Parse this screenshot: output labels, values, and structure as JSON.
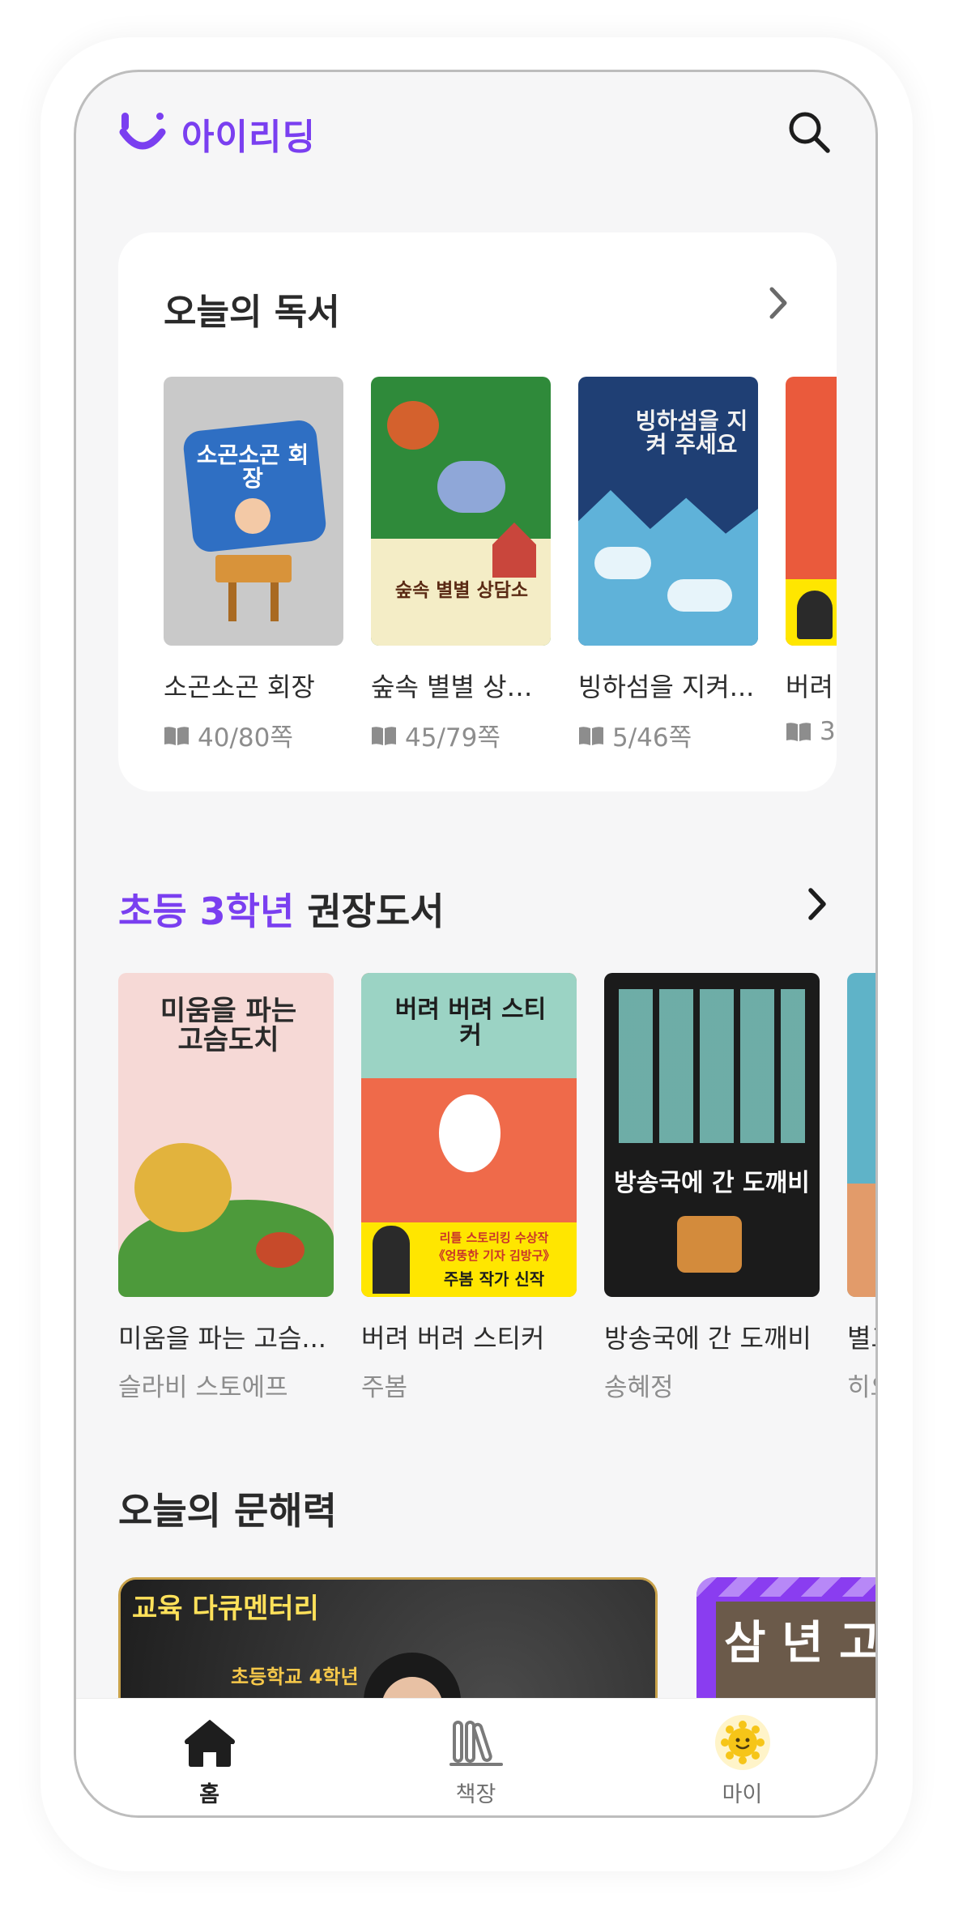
{
  "app": {
    "logo_text": "아이리딩",
    "accent_color": "#7a3ff0"
  },
  "header": {
    "search_icon": "search-icon"
  },
  "today_reading": {
    "title": "오늘의 독서",
    "books": [
      {
        "title": "소곤소곤 회장",
        "progress": "40/80쪽",
        "cover_text": "소곤소곤 회장"
      },
      {
        "title": "숲속 별별 상담소",
        "progress": "45/79쪽",
        "cover_text": "숲속 별별 상담소"
      },
      {
        "title": "빙하섬을 지켜...",
        "progress": "5/46쪽",
        "cover_text": "빙하섬을 지켜 주세요"
      },
      {
        "title": "버려",
        "progress": "3"
      }
    ]
  },
  "grade_section": {
    "highlight": "초등 3학년",
    "rest": " 권장도서",
    "books": [
      {
        "title": "미움을 파는 고슴...",
        "author": "슬라비 스토에프",
        "cover_text": "미움을 파는 고슴도치"
      },
      {
        "title": "버려 버려 스티커",
        "author": "주봄",
        "cover_text": "버려 버려 스티커",
        "banner_line1": "리틀 스토리킹 수상작",
        "banner_line2": "《엉뚱한 기자 김방구》",
        "banner_line3": "주봄 작가 신작"
      },
      {
        "title": "방송국에 간 도깨비",
        "author": "송혜정",
        "cover_text": "방송국에 간 도깨비"
      },
      {
        "title": "별고",
        "author": "히요"
      }
    ]
  },
  "literacy": {
    "title": "오늘의 문해력",
    "videos": [
      {
        "label": "교육 다큐멘터리",
        "sub": "초등학교 4학년"
      },
      {
        "label": "삼 년 고개"
      }
    ]
  },
  "bottom_nav": [
    {
      "label": "홈",
      "icon": "home-icon",
      "active": true
    },
    {
      "label": "책장",
      "icon": "bookshelf-icon",
      "active": false
    },
    {
      "label": "마이",
      "icon": "profile-sun-icon",
      "active": false
    }
  ]
}
